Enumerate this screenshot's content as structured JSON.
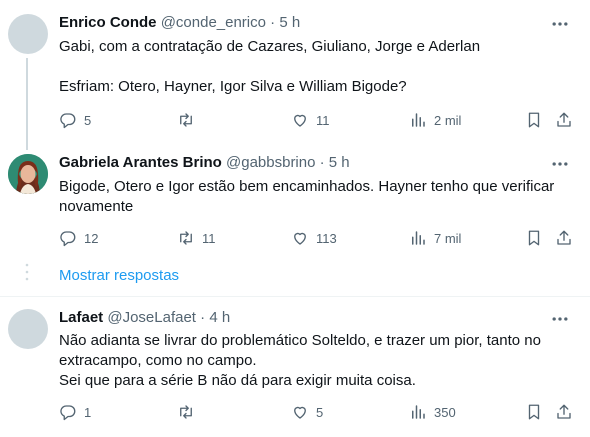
{
  "tweets": [
    {
      "name": "Enrico Conde",
      "handle": "@conde_enrico",
      "dot": "·",
      "time": "5 h",
      "text": "Gabi, com a contratação de Cazares, Giuliano, Jorge e Aderlan\n\nEsfriam: Otero, Hayner, Igor Silva e William Bigode?",
      "replies": "5",
      "retweets": "",
      "likes": "11",
      "views": "2 mil"
    },
    {
      "name": "Gabriela Arantes Brino",
      "handle": "@gabbsbrino",
      "dot": "·",
      "time": "5 h",
      "text": "Bigode, Otero e Igor estão bem encaminhados. Hayner tenho que verificar novamente",
      "replies": "12",
      "retweets": "11",
      "likes": "113",
      "views": "7 mil"
    },
    {
      "name": "Lafaet",
      "handle": "@JoseLafaet",
      "dot": "·",
      "time": "4 h",
      "text": "Não adianta se livrar do problemático Solteldo, e trazer um pior, tanto no extracampo, como no campo.\nSei que para a série B não dá para exigir muita coisa.",
      "replies": "1",
      "retweets": "",
      "likes": "5",
      "views": "350"
    }
  ],
  "show_replies_label": "Mostrar respostas",
  "icons": [
    "reply-icon",
    "retweet-icon",
    "like-icon",
    "views-icon",
    "bookmark-icon",
    "share-icon",
    "more-icon"
  ],
  "colors": {
    "link": "#1d9bf0",
    "secondary": "#536471",
    "line": "#cfd9de"
  }
}
